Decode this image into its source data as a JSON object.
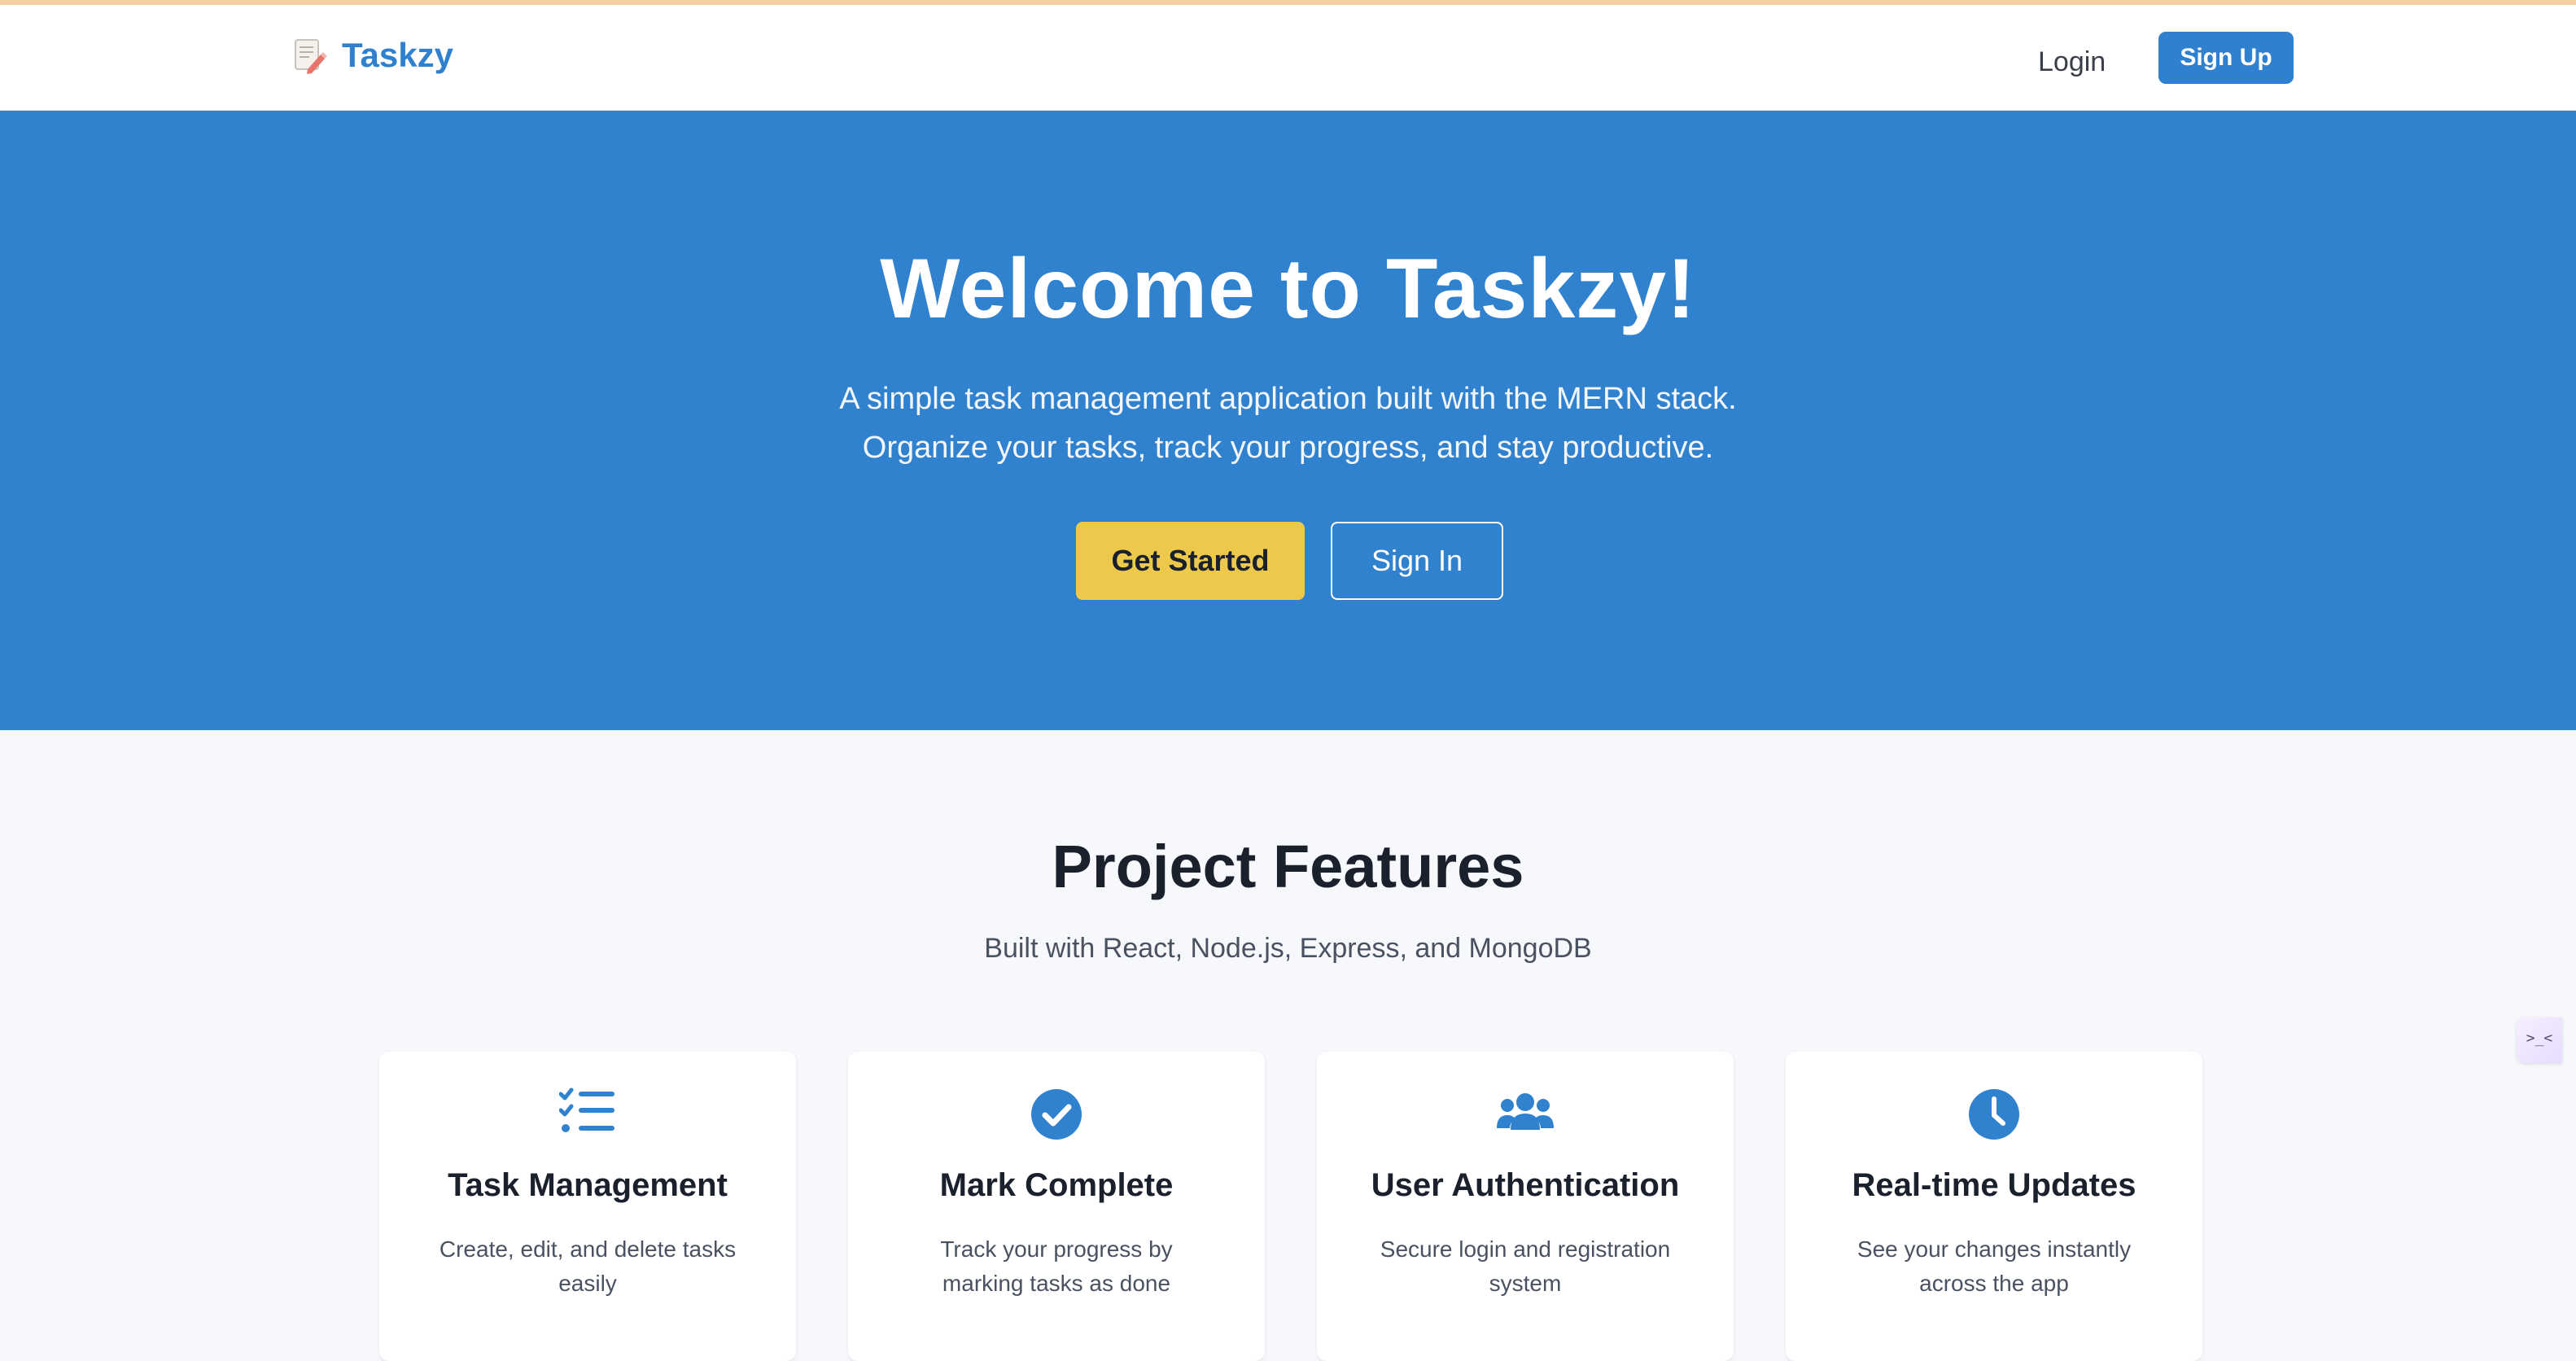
{
  "colors": {
    "primary": "#3182ce",
    "accent_yellow": "#ecc94b",
    "page_bg": "#f6f8fb",
    "text_dark": "#1a202c"
  },
  "navbar": {
    "brand_icon": "memo-pencil-icon",
    "brand_name": "Taskzy",
    "login_label": "Login",
    "signup_label": "Sign Up"
  },
  "hero": {
    "title": "Welcome to Taskzy!",
    "subtitle_line1": "A simple task management application built with the MERN stack.",
    "subtitle_line2": "Organize your tasks, track your progress, and stay productive.",
    "primary_button": "Get Started",
    "secondary_button": "Sign In"
  },
  "features": {
    "title": "Project Features",
    "subtitle": "Built with React, Node.js, Express, and MongoDB",
    "cards": [
      {
        "icon": "task-list-icon",
        "title": "Task Management",
        "description": "Create, edit, and delete tasks easily"
      },
      {
        "icon": "check-circle-icon",
        "title": "Mark Complete",
        "description": "Track your progress by marking tasks as done"
      },
      {
        "icon": "users-icon",
        "title": "User Authentication",
        "description": "Secure login and registration system"
      },
      {
        "icon": "clock-icon",
        "title": "Real-time Updates",
        "description": "See your changes instantly across the app"
      }
    ]
  },
  "side_widget": {
    "icon": "extension-widget-icon",
    "glyph": ">_<"
  }
}
